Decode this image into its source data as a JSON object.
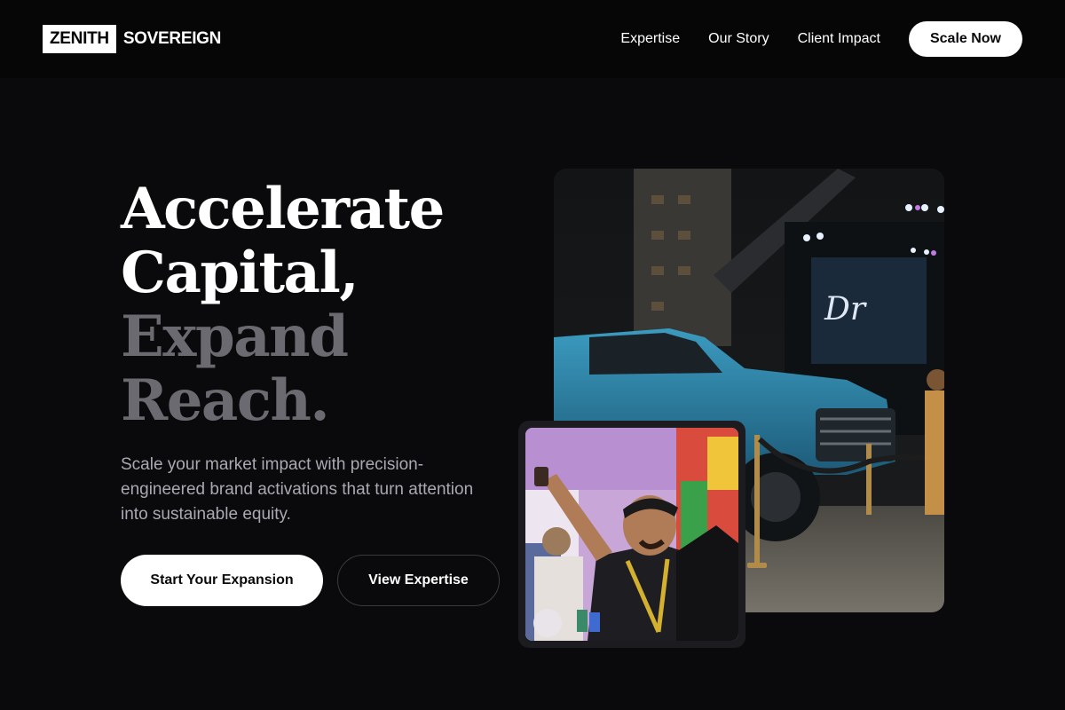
{
  "brand": {
    "logo_box": "ZENITH",
    "logo_text": "SOVEREIGN"
  },
  "nav": {
    "links": [
      "Expertise",
      "Our Story",
      "Client Impact"
    ],
    "cta": "Scale Now"
  },
  "hero": {
    "headline_lines": [
      "Accelerate",
      "Capital,",
      "Expand",
      "Reach."
    ],
    "subheadline": "Scale your market impact with precision-engineered brand activations that turn attention into sustainable equity.",
    "primary_button": "Start Your Expansion",
    "secondary_button": "View Expertise"
  },
  "colors": {
    "background": "#0a0a0c",
    "header": "#060607",
    "headline_white": "#ffffff",
    "headline_gray": "#6b6a70",
    "body_text": "#a9a9b2"
  }
}
